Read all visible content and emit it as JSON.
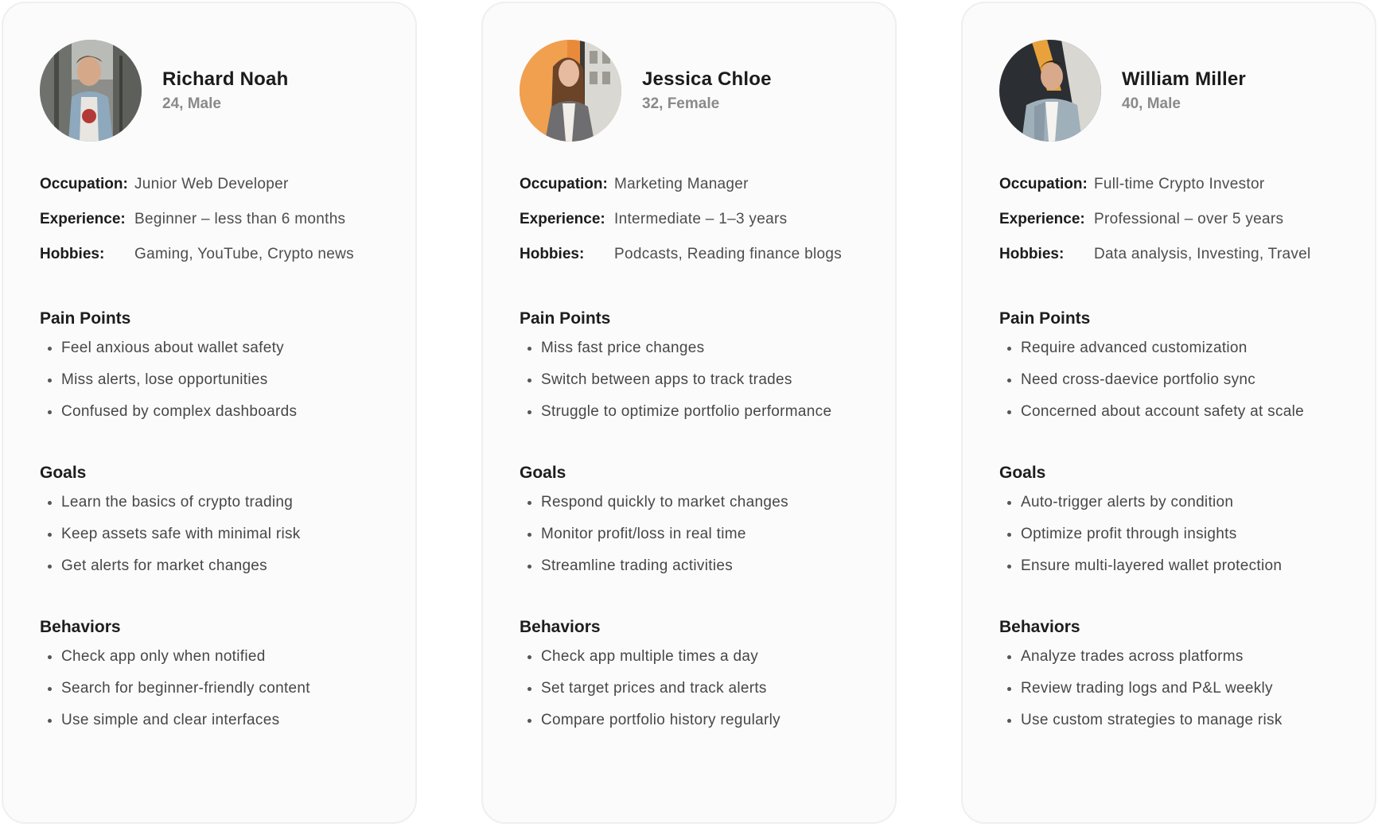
{
  "personas": [
    {
      "name": "Richard Noah",
      "meta": "24, Male",
      "avatar": "avatar-richard",
      "details": [
        {
          "label": "Occupation:",
          "value": "Junior Web Developer"
        },
        {
          "label": "Experience:",
          "value": "Beginner – less than 6 months"
        },
        {
          "label": "Hobbies:",
          "value": "Gaming, YouTube, Crypto news"
        }
      ],
      "sections": [
        {
          "title": "Pain Points",
          "items": [
            "Feel anxious about wallet safety",
            "Miss alerts, lose opportunities",
            "Confused by complex dashboards"
          ]
        },
        {
          "title": "Goals",
          "items": [
            "Learn the basics of crypto trading",
            "Keep assets safe with minimal risk",
            "Get alerts for market changes"
          ]
        },
        {
          "title": "Behaviors",
          "items": [
            "Check app only when notified",
            "Search for beginner-friendly content",
            "Use simple and clear interfaces"
          ]
        }
      ]
    },
    {
      "name": "Jessica Chloe",
      "meta": "32, Female",
      "avatar": "avatar-jessica",
      "details": [
        {
          "label": "Occupation:",
          "value": "Marketing Manager"
        },
        {
          "label": "Experience:",
          "value": "Intermediate – 1–3 years"
        },
        {
          "label": "Hobbies:",
          "value": "Podcasts, Reading finance blogs"
        }
      ],
      "sections": [
        {
          "title": "Pain Points",
          "items": [
            "Miss fast price changes",
            "Switch between apps to track trades",
            "Struggle to optimize portfolio performance"
          ]
        },
        {
          "title": "Goals",
          "items": [
            "Respond quickly to market changes",
            "Monitor profit/loss in real time",
            "Streamline trading activities"
          ]
        },
        {
          "title": "Behaviors",
          "items": [
            "Check app multiple times a day",
            "Set target prices and track alerts",
            "Compare portfolio history regularly"
          ]
        }
      ]
    },
    {
      "name": "William Miller",
      "meta": "40, Male",
      "avatar": "avatar-william",
      "details": [
        {
          "label": "Occupation:",
          "value": "Full-time Crypto Investor"
        },
        {
          "label": "Experience:",
          "value": "Professional – over 5 years"
        },
        {
          "label": "Hobbies:",
          "value": "Data analysis, Investing, Travel"
        }
      ],
      "sections": [
        {
          "title": "Pain Points",
          "items": [
            "Require advanced customization",
            "Need cross-daevice portfolio sync",
            "Concerned about account safety at scale"
          ]
        },
        {
          "title": "Goals",
          "items": [
            "Auto-trigger alerts by condition",
            "Optimize profit through insights",
            "Ensure multi-layered wallet protection"
          ]
        },
        {
          "title": "Behaviors",
          "items": [
            "Analyze trades across platforms",
            "Review trading logs and P&L weekly",
            "Use custom strategies to manage risk"
          ]
        }
      ]
    }
  ]
}
